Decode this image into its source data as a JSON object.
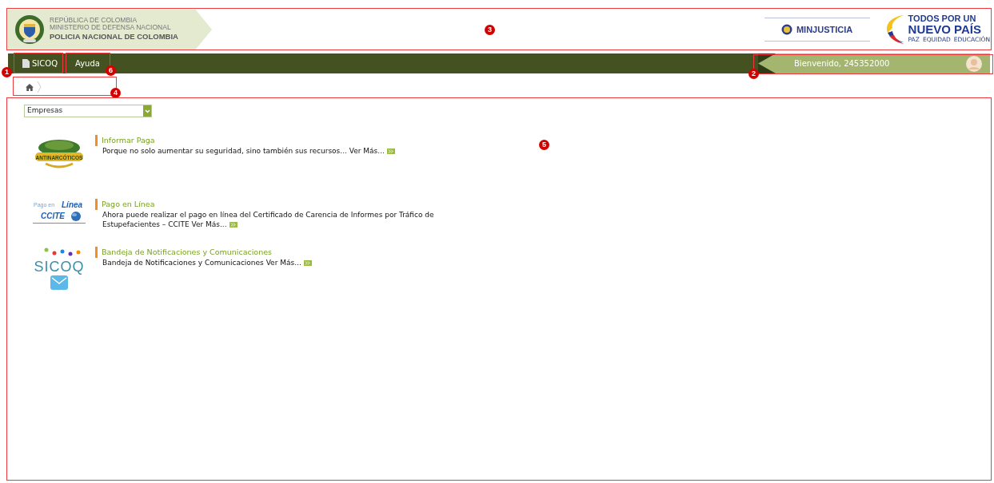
{
  "header": {
    "agency_lines": [
      "REPÚBLICA DE COLOMBIA",
      "MINISTERIO DE DEFENSA NACIONAL"
    ],
    "agency_name": "POLICIA NACIONAL DE COLOMBIA",
    "ministry": "MINJUSTICIA",
    "slogan_lines": [
      "TODOS POR UN",
      "NUEVO PAÍS"
    ],
    "slogan_words": [
      "PAZ",
      "EQUIDAD",
      "EDUCACIÓN"
    ]
  },
  "menu": [
    {
      "label": "SICOQ",
      "kind": "app"
    },
    {
      "label": "Ayuda",
      "kind": "plain"
    }
  ],
  "user": {
    "greeting": "Bienvenido, 245352000"
  },
  "filter": {
    "value": "Empresas"
  },
  "items": [
    {
      "kind": "antinarcoticos",
      "logo_text": "ANTINARCÓTICOS",
      "title": "Informar Paga",
      "text": "Porque no solo aumentar su seguridad, sino también sus recursos... Ver Más..."
    },
    {
      "kind": "ccite",
      "logo_text": [
        "Pago en",
        "Línea",
        "CCITE"
      ],
      "title": "Pago en Línea",
      "text": "Ahora puede realizar el pago en línea del Certificado de Carencia de Informes por Tráfico de Estupefacientes – CCITE Ver Más..."
    },
    {
      "kind": "sicoq",
      "logo_text": "SICOQ",
      "title": "Bandeja de Notificaciones y Comunicaciones",
      "text": "Bandeja de Notificaciones y Comunicaciones Ver Más..."
    }
  ],
  "callouts": [
    {
      "number": "1",
      "kind": "menu0"
    },
    {
      "number": "2",
      "kind": "user"
    },
    {
      "number": "3",
      "kind": "header"
    },
    {
      "number": "4",
      "kind": "crumb"
    },
    {
      "number": "5",
      "kind": "main"
    },
    {
      "number": "6",
      "kind": "menu1"
    }
  ]
}
